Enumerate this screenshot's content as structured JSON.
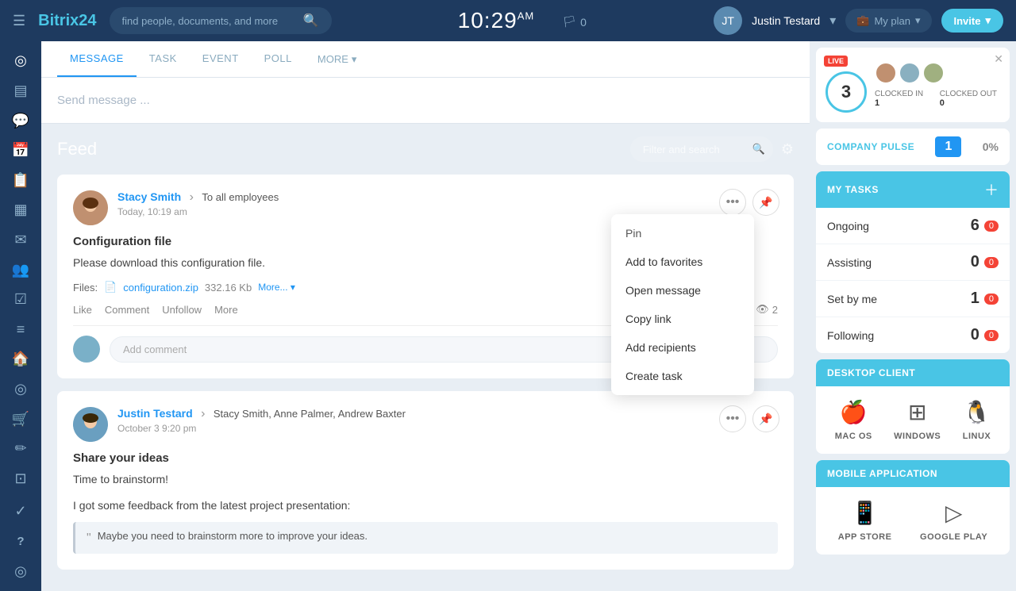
{
  "app": {
    "name": "Bitrix",
    "name_suffix": "24",
    "time": "10:29",
    "time_suffix": "AM",
    "flag": "🏳",
    "flag_count": "0"
  },
  "nav": {
    "search_placeholder": "find people, documents, and more",
    "user_name": "Justin Testard",
    "my_plan_label": "My plan",
    "invite_label": "Invite"
  },
  "compose": {
    "tabs": [
      "MESSAGE",
      "TASK",
      "EVENT",
      "POLL"
    ],
    "more_label": "MORE",
    "placeholder": "Send message ..."
  },
  "feed": {
    "title": "Feed",
    "filter_placeholder": "Filter and search"
  },
  "posts": [
    {
      "author": "Stacy Smith",
      "recipient": "To all employees",
      "time": "Today, 10:19 am",
      "title": "Configuration file",
      "body": "Please download this configuration file.",
      "file_label": "Files:",
      "file_name": "configuration.zip",
      "file_size": "332.16 Kb",
      "file_more": "More...",
      "actions": [
        "Like",
        "Comment",
        "Unfollow",
        "More"
      ],
      "views": "2",
      "comment_placeholder": "Add comment"
    },
    {
      "author": "Justin Testard",
      "recipient": "Stacy Smith, Anne Palmer, Andrew Baxter",
      "time": "October 3 9:20 pm",
      "title": "Share your ideas",
      "body": "Time to brainstorm!",
      "quote": "Maybe you need to brainstorm more to improve your ideas.",
      "actions": [],
      "views": "",
      "comment_placeholder": ""
    }
  ],
  "context_menu": {
    "items": [
      "Pin",
      "Add to favorites",
      "Open message",
      "Copy link",
      "Add recipients",
      "Create task"
    ]
  },
  "right_panel": {
    "live": {
      "badge": "LIVE",
      "count": "3",
      "clocked_in_label": "CLOCKED IN",
      "clocked_in_val": "1",
      "clocked_out_label": "CLOCKED OUT",
      "clocked_out_val": "0"
    },
    "company_pulse": {
      "label": "COMPANY PULSE",
      "count": "1",
      "percent": "0%"
    },
    "my_tasks": {
      "label": "MY TASKS",
      "rows": [
        {
          "label": "Ongoing",
          "count": "6",
          "badge": "0"
        },
        {
          "label": "Assisting",
          "count": "0",
          "badge": "0"
        },
        {
          "label": "Set by me",
          "count": "1",
          "badge": "0"
        },
        {
          "label": "Following",
          "count": "0",
          "badge": "0"
        }
      ]
    },
    "desktop_client": {
      "label": "DESKTOP CLIENT",
      "platforms": [
        "MAC OS",
        "WINDOWS",
        "LINUX"
      ]
    },
    "mobile_app": {
      "label": "MOBILE APPLICATION",
      "stores": [
        "APP STORE",
        "GOOGLE PLAY"
      ]
    }
  },
  "sidebar": {
    "items": [
      {
        "icon": "◎",
        "name": "activity"
      },
      {
        "icon": "◻",
        "name": "feed"
      },
      {
        "icon": "💬",
        "name": "chat"
      },
      {
        "icon": "📅",
        "name": "calendar"
      },
      {
        "icon": "📋",
        "name": "tasks-list"
      },
      {
        "icon": "📦",
        "name": "crm"
      },
      {
        "icon": "✉",
        "name": "mail"
      },
      {
        "icon": "👥",
        "name": "contacts"
      },
      {
        "icon": "☑",
        "name": "tasks"
      },
      {
        "icon": "≡",
        "name": "filters"
      },
      {
        "icon": "🏠",
        "name": "home"
      },
      {
        "icon": "◎",
        "name": "goals"
      },
      {
        "icon": "🛒",
        "name": "shop"
      },
      {
        "icon": "✏",
        "name": "sign"
      },
      {
        "icon": "⊡",
        "name": "storage"
      },
      {
        "icon": "⚙",
        "name": "settings2"
      },
      {
        "icon": "✓",
        "name": "check"
      },
      {
        "icon": "?",
        "name": "help"
      },
      {
        "icon": "◎",
        "name": "profile"
      }
    ]
  }
}
